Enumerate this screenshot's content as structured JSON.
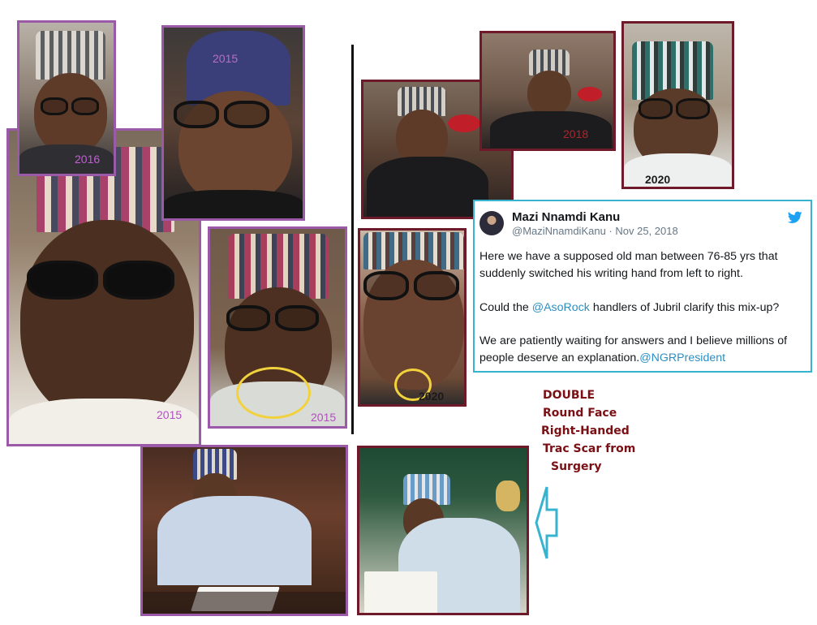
{
  "collage": {
    "years": {
      "top_left": "2016",
      "top_center": "2015",
      "big_left": "2015",
      "mid_left": "2015",
      "mid_center": "2020",
      "right_top_middle": "2018",
      "right_top_right": "2020"
    }
  },
  "tweet": {
    "name": "Mazi Nnamdi Kanu",
    "handle": "@MaziNnamdiKanu",
    "separator": " · ",
    "date": "Nov 25, 2018",
    "paragraph1": "Here we have a supposed old man between 76-85 yrs that suddenly switched his writing hand from left to right.",
    "paragraph2_before": "Could the ",
    "paragraph2_link": "@AsoRock",
    "paragraph2_after": " handlers of Jubril clarify this mix-up?",
    "paragraph3": "We are patiently waiting for answers and I believe millions of people deserve an explanation.",
    "paragraph3_link": "@NGRPresident",
    "icon": "twitter-bird-icon",
    "link_color": "#2b8fc4",
    "border_color": "#38b3cf"
  },
  "caption": {
    "line1": "DOUBLE",
    "line2": "Round Face",
    "line3": "Right-Handed",
    "line4": "Trac Scar from",
    "line5": "Surgery",
    "color": "#7a0f14"
  },
  "arrow": {
    "icon": "left-arrow-icon",
    "color": "#38b3cf"
  }
}
